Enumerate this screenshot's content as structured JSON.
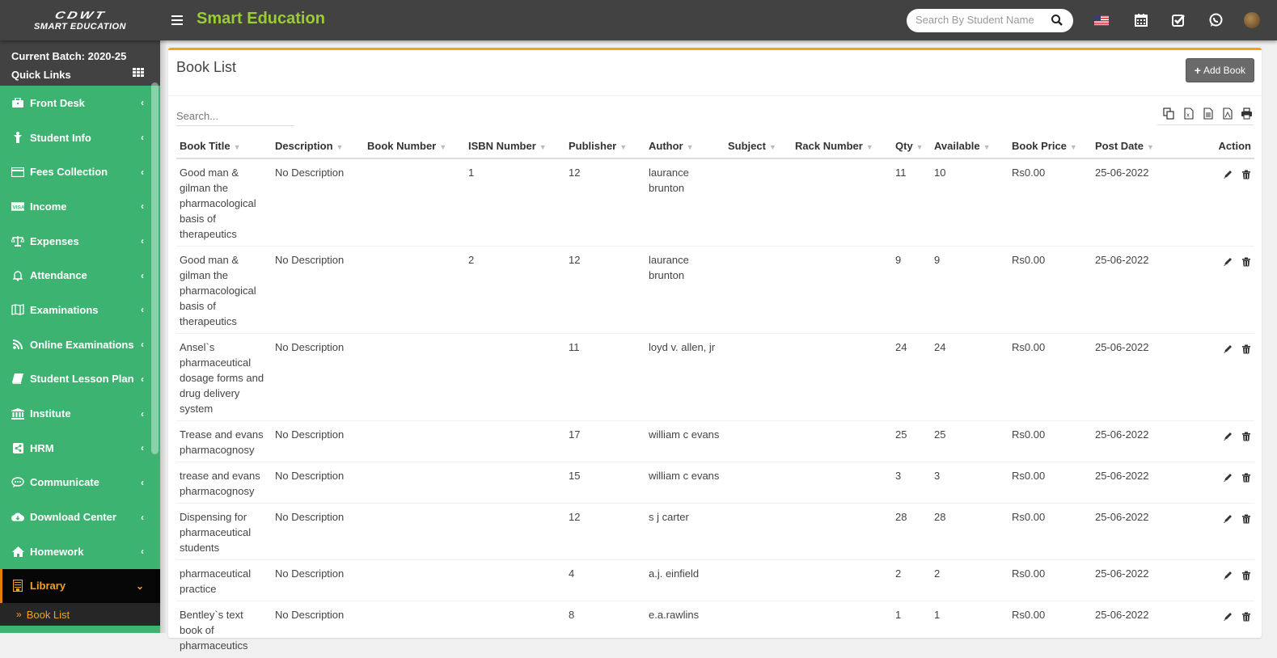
{
  "header": {
    "logo_line1": "CDWT",
    "logo_line2": "SMART EDUCATION",
    "app_title": "Smart Education",
    "search_placeholder": "Search By Student Name",
    "icons": [
      "menu-icon",
      "search-icon",
      "us-flag-icon",
      "calendar-icon",
      "task-check-icon",
      "whatsapp-icon",
      "user-avatar"
    ]
  },
  "sidebar": {
    "batch_label": "Current Batch: 2020-25",
    "quick_links_label": "Quick Links",
    "items": [
      {
        "label": "Front Desk",
        "icon": "briefcase-icon"
      },
      {
        "label": "Student Info",
        "icon": "student-icon"
      },
      {
        "label": "Fees Collection",
        "icon": "credit-card-icon"
      },
      {
        "label": "Income",
        "icon": "visa-card-icon"
      },
      {
        "label": "Expenses",
        "icon": "balance-scale-icon"
      },
      {
        "label": "Attendance",
        "icon": "bell-icon"
      },
      {
        "label": "Examinations",
        "icon": "map-icon"
      },
      {
        "label": "Online Examinations",
        "icon": "rss-icon"
      },
      {
        "label": "Student Lesson Plan",
        "icon": "book-icon"
      },
      {
        "label": "Institute",
        "icon": "bank-icon"
      },
      {
        "label": "HRM",
        "icon": "share-icon"
      },
      {
        "label": "Communicate",
        "icon": "chat-icon"
      },
      {
        "label": "Download Center",
        "icon": "cloud-download-icon"
      },
      {
        "label": "Homework",
        "icon": "home-icon"
      },
      {
        "label": "Library",
        "icon": "library-icon",
        "active": true
      }
    ],
    "sub_items": [
      {
        "label": "Book List",
        "active": true
      }
    ]
  },
  "main": {
    "title": "Book List",
    "add_button": "Add Book",
    "search_placeholder": "Search...",
    "export_buttons": [
      "copy",
      "excel",
      "csv",
      "pdf",
      "print"
    ],
    "columns": [
      "Book Title",
      "Description",
      "Book Number",
      "ISBN Number",
      "Publisher",
      "Author",
      "Subject",
      "Rack Number",
      "Qty",
      "Available",
      "Book Price",
      "Post Date",
      "Action"
    ],
    "rows": [
      {
        "title": "Good man & gilman the pharmacological basis of therapeutics",
        "description": "No Description",
        "book_number": "",
        "isbn": "1",
        "publisher": "12",
        "author": "laurance brunton",
        "subject": "",
        "rack": "",
        "qty": "11",
        "available": "10",
        "price": "Rs0.00",
        "post_date": "25-06-2022"
      },
      {
        "title": "Good man & gilman the pharmacological basis of therapeutics",
        "description": "No Description",
        "book_number": "",
        "isbn": "2",
        "publisher": "12",
        "author": "laurance brunton",
        "subject": "",
        "rack": "",
        "qty": "9",
        "available": "9",
        "price": "Rs0.00",
        "post_date": "25-06-2022"
      },
      {
        "title": "Ansel`s pharmaceutical dosage forms and drug delivery system",
        "description": "No Description",
        "book_number": "",
        "isbn": "",
        "publisher": "11",
        "author": "loyd v. allen, jr",
        "subject": "",
        "rack": "",
        "qty": "24",
        "available": "24",
        "price": "Rs0.00",
        "post_date": "25-06-2022"
      },
      {
        "title": "Trease and evans pharmacognosy",
        "description": "No Description",
        "book_number": "",
        "isbn": "",
        "publisher": "17",
        "author": "william c evans",
        "subject": "",
        "rack": "",
        "qty": "25",
        "available": "25",
        "price": "Rs0.00",
        "post_date": "25-06-2022"
      },
      {
        "title": "trease and evans pharmacognosy",
        "description": "No Description",
        "book_number": "",
        "isbn": "",
        "publisher": "15",
        "author": "william c evans",
        "subject": "",
        "rack": "",
        "qty": "3",
        "available": "3",
        "price": "Rs0.00",
        "post_date": "25-06-2022"
      },
      {
        "title": "Dispensing for pharmaceutical students",
        "description": "No Description",
        "book_number": "",
        "isbn": "",
        "publisher": "12",
        "author": "s j carter",
        "subject": "",
        "rack": "",
        "qty": "28",
        "available": "28",
        "price": "Rs0.00",
        "post_date": "25-06-2022"
      },
      {
        "title": "pharmaceutical practice",
        "description": "No Description",
        "book_number": "",
        "isbn": "",
        "publisher": "4",
        "author": "a.j. einfield",
        "subject": "",
        "rack": "",
        "qty": "2",
        "available": "2",
        "price": "Rs0.00",
        "post_date": "25-06-2022"
      },
      {
        "title": "Bentley`s text book of pharmaceutics",
        "description": "No Description",
        "book_number": "",
        "isbn": "",
        "publisher": "8",
        "author": "e.a.rawlins",
        "subject": "",
        "rack": "",
        "qty": "1",
        "available": "1",
        "price": "Rs0.00",
        "post_date": "25-06-2022"
      }
    ]
  },
  "colors": {
    "header_bg": "#424242",
    "sidebar_bg": "#3cb371",
    "accent_orange": "#f7a11a",
    "title_green": "#9acd32",
    "active_text": "#f0a030"
  }
}
